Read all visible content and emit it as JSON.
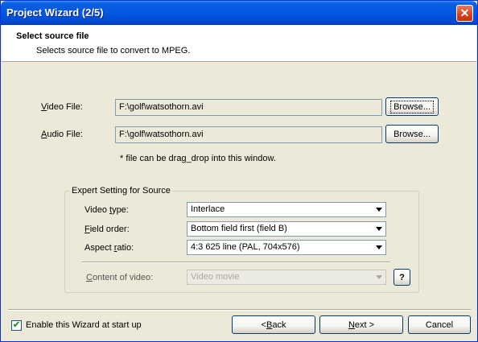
{
  "window": {
    "title": "Project Wizard (2/5)",
    "close_glyph": "✕"
  },
  "header": {
    "title": "Select source file",
    "subtitle": "Selects source file to convert to MPEG."
  },
  "source": {
    "video_label_mn": "V",
    "video_label_rest": "ideo File:",
    "video_path": "F:\\golf\\watsothorn.avi",
    "audio_label_mn": "A",
    "audio_label_rest": "udio File:",
    "audio_path": "F:\\golf\\watsothorn.avi",
    "browse_label": "Browse...",
    "hint": "* file can be drag_drop into this window."
  },
  "expert": {
    "group_title": "Expert Setting for Source",
    "video_type_label_pre": "Video ",
    "video_type_label_mn": "t",
    "video_type_label_post": "ype:",
    "video_type_value": "Interlace",
    "field_order_label_mn": "F",
    "field_order_label_post": "ield order:",
    "field_order_value": "Bottom field first (field B)",
    "aspect_label_pre": "Aspect ",
    "aspect_label_mn": "r",
    "aspect_label_post": "atio:",
    "aspect_value": "4:3 625 line (PAL, 704x576)",
    "content_label_mn": "C",
    "content_label_post": "ontent of video:",
    "content_value": "Video movie",
    "help_label": "?"
  },
  "footer": {
    "checkbox_label": "Enable this Wizard at start up",
    "checkbox_checked": true,
    "checkbox_glyph": "✔",
    "back_pre": "< ",
    "back_mn": "B",
    "back_post": "ack",
    "next_mn": "N",
    "next_post": "ext >",
    "cancel_label": "Cancel"
  },
  "colors": {
    "titlebar": "#0458e3",
    "dialog_bg": "#ece9d8",
    "accent_border": "#003c74"
  }
}
